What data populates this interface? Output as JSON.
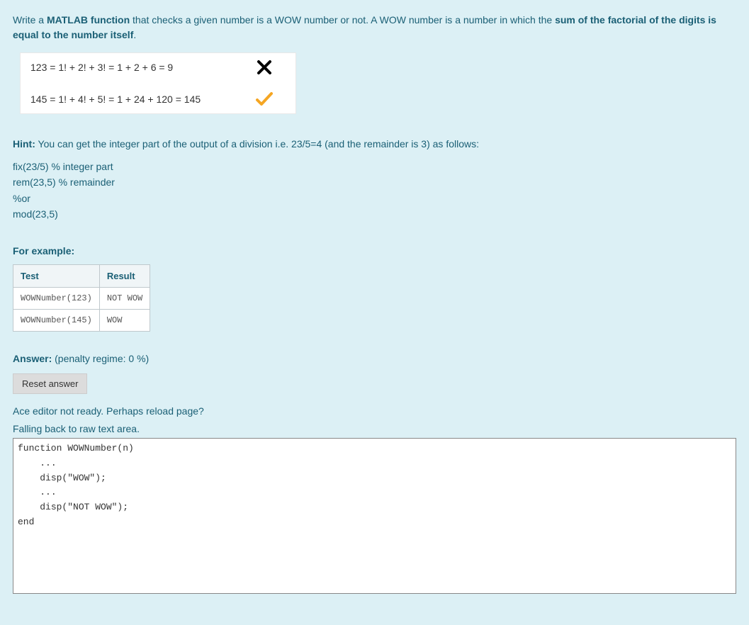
{
  "problem": {
    "prefix": "Write a ",
    "bold1": "MATLAB function",
    "mid": " that checks a given number is a WOW number or not. A WOW number is a number in which the ",
    "bold2": "sum of the factorial of the digits is equal to the number itself",
    "suffix": "."
  },
  "examples": {
    "row1": "123 = 1! + 2! + 3! = 1 + 2 + 6 = 9",
    "row2": "145 = 1! + 4! + 5! = 1 + 24 + 120 =  145"
  },
  "hint": {
    "label": "Hint:",
    "text": " You can get the integer part of the output of a division i.e. 23/5=4 (and the remainder is 3) as follows:",
    "line1": "fix(23/5) % integer part",
    "line2": "rem(23,5) % remainder",
    "line3": "%or",
    "line4": "mod(23,5)"
  },
  "for_example": "For example:",
  "table": {
    "h1": "Test",
    "h2": "Result",
    "rows": [
      {
        "test": "WOWNumber(123)",
        "result": "NOT WOW"
      },
      {
        "test": "WOWNumber(145)",
        "result": "WOW"
      }
    ]
  },
  "answer": {
    "label": "Answer:",
    "penalty": "  (penalty regime: 0 %)"
  },
  "reset_btn": "Reset answer",
  "ace_msg1": "Ace editor not ready. Perhaps reload page?",
  "ace_msg2": "Falling back to raw text area.",
  "code": "function WOWNumber(n)\n    ...\n    disp(\"WOW\");\n    ...\n    disp(\"NOT WOW\");\nend"
}
